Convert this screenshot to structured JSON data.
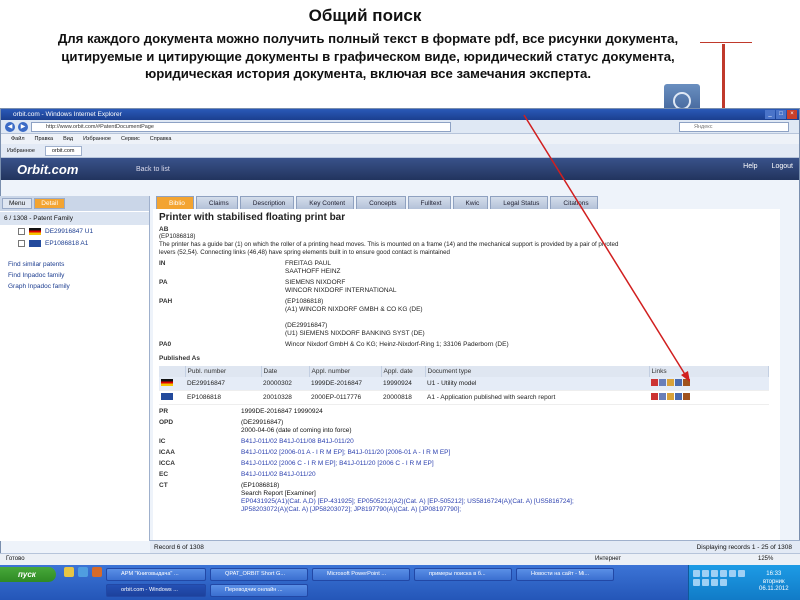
{
  "slide": {
    "title": "Общий поиск",
    "description": "Для каждого документа можно получить полный текст в формате pdf, все рисунки документа, цитируемые и цитирующие документы в графическом виде, юридический статус документа, юридическая история документа, включая все замечания эксперта."
  },
  "browser": {
    "window_title": "orbit.com - Windows Internet Explorer",
    "address": "http://www.orbit.com/#PatentDocumentPage",
    "search_placeholder": "Яндекс",
    "menu": [
      "Файл",
      "Правка",
      "Вид",
      "Избранное",
      "Сервис",
      "Справка"
    ],
    "favorites_label": "Избранное",
    "tab_label": "orbit.com",
    "status_left": "Готово",
    "zone": "Интернет",
    "zoom": "125%"
  },
  "app": {
    "logo": "Orbit.com",
    "back_label": "Back to list",
    "help_label": "Help",
    "logout_label": "Logout",
    "sidebar_tabs": [
      "Menu",
      "Detail"
    ],
    "family_label": "6 / 1308 - Patent Family",
    "family_items": [
      "DE29916847 U1",
      "EP1086818 A1"
    ],
    "links": [
      "Find similar patents",
      "Find Inpadoc family",
      "Graph Inpadoc family"
    ],
    "doc_tabs": [
      "Biblio",
      "Claims",
      "Description",
      "Key Content",
      "Concepts",
      "Fulltext",
      "Kwic",
      "Legal Status",
      "Citations"
    ]
  },
  "document": {
    "title": "Printer with stabilised floating print bar",
    "ab_label": "AB",
    "ab_text": [
      "(EP1086818)",
      "The printer has a guide bar (1) on which the roller of a printing head moves. This is mounted on a frame (14) and the mechanical support is provided by a pair of pivoted",
      "levers (52,54). Connecting links (46,48) have spring elements built in to ensure good contact is maintained"
    ],
    "in_label": "IN",
    "in_values": [
      "FREITAG PAUL",
      "SAATHOFF HEINZ"
    ],
    "pa_label": "PA",
    "pa_values": [
      "SIEMENS NIXDORF",
      "WINCOR NIXDORF INTERNATIONAL"
    ],
    "pah_label": "PAH",
    "pah_values": [
      "(EP1086818)",
      "(A1) WINCOR NIXDORF GMBH & CO KG (DE)",
      "",
      "(DE29916847)",
      "(U1) SIEMENS NIXDORF BANKING SYST (DE)"
    ],
    "pa0_label": "PA0",
    "pa0_value": "Wincor Nixdorf GmbH & Co KG; Heinz-Nixdorf-Ring 1; 33106 Paderborn (DE)",
    "published_label": "Published As",
    "pub_headers": [
      "Publ. number",
      "Date",
      "Appl. number",
      "Appl. date",
      "Document type",
      "Links"
    ],
    "pub_rows": [
      {
        "publ_number": "DE29916847",
        "date": "20000302",
        "appl_number": "1999DE-2016847",
        "appl_date": "19990924",
        "doc_type": "U1 - Utility model"
      },
      {
        "publ_number": "EP1086818",
        "date": "20010328",
        "appl_number": "2000EP-0117776",
        "appl_date": "20000818",
        "doc_type": "A1 - Application published with search report"
      }
    ],
    "pr_label": "PR",
    "pr_value": "1999DE-2016847 19990924",
    "opd_label": "OPD",
    "opd_values": [
      "(DE29916847)",
      "2000-04-06 (date of coming into force)"
    ],
    "ic_label": "IC",
    "ic_value": "B41J-011/02 B41J-011/08 B41J-011/20",
    "icaa_label": "ICAA",
    "icaa_value": "B41J-011/02 [2006-01 A - I R M EP];  B41J-011/20 [2006-01 A - I R M EP]",
    "icca_label": "ICCA",
    "icca_value": "B41J-011/02 [2006 C - I R M EP];  B41J-011/20 [2006 C - I R M EP]",
    "ec_label": "EC",
    "ec_value": "B41J-011/02 B41J-011/20",
    "ct_label": "CT",
    "ct_values": [
      "(EP1086818)",
      "Search Report [Examiner]",
      " EP0431925(A1)(Cat. A,D) [EP-431925];  EP0505212(A2)(Cat. A) [EP-505212];  US5816724(A)(Cat. A) [US5816724];",
      "JP58203072(A)(Cat. A) [JP58203072];  JP8197790(A)(Cat. A) [JP08197790];"
    ]
  },
  "status": {
    "record": "Record 6 of 1308",
    "displaying": "Displaying records 1 - 25 of 1308"
  },
  "taskbar": {
    "start_label": "пуск",
    "tasks": [
      "APM \"Книговыдача\" ...",
      "QPAT_ORBIT Short G...",
      "Microsoft PowerPoint ...",
      "примеры поиска в б...",
      "Новости на сайт - Mi...",
      "orbit.com - Windows ...",
      "Переводчик онлайн ..."
    ],
    "time": "16:33",
    "weekday": "вторник",
    "date": "06.11.2012"
  },
  "colors": {
    "active_tab": "#f3a431",
    "orbit_header": "#22345e",
    "arrow": "#d11f1f",
    "link": "#2a3fae"
  }
}
